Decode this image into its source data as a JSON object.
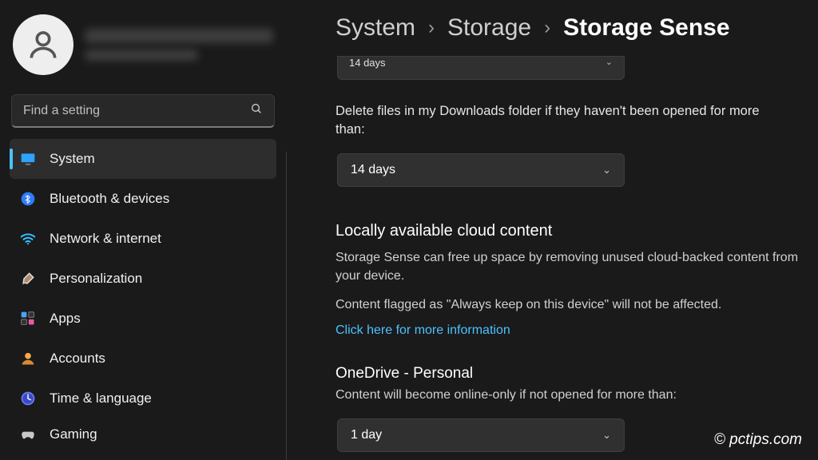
{
  "search": {
    "placeholder": "Find a setting"
  },
  "sidebar": {
    "items": [
      {
        "label": "System"
      },
      {
        "label": "Bluetooth & devices"
      },
      {
        "label": "Network & internet"
      },
      {
        "label": "Personalization"
      },
      {
        "label": "Apps"
      },
      {
        "label": "Accounts"
      },
      {
        "label": "Time & language"
      },
      {
        "label": "Gaming"
      }
    ]
  },
  "breadcrumb": {
    "a": "System",
    "b": "Storage",
    "c": "Storage Sense"
  },
  "main": {
    "dd0_value": "14 days",
    "downloads_label": "Delete files in my Downloads folder if they haven't been opened for more than:",
    "dd1_value": "14 days",
    "cloud_title": "Locally available cloud content",
    "cloud_p1": "Storage Sense can free up space by removing unused cloud-backed content from your device.",
    "cloud_p2": "Content flagged as \"Always keep on this device\" will not be affected.",
    "cloud_link": "Click here for more information",
    "onedrive_title": "OneDrive - Personal",
    "onedrive_label": "Content will become online-only if not opened for more than:",
    "dd2_value": "1 day"
  },
  "watermark": "© pctips.com"
}
